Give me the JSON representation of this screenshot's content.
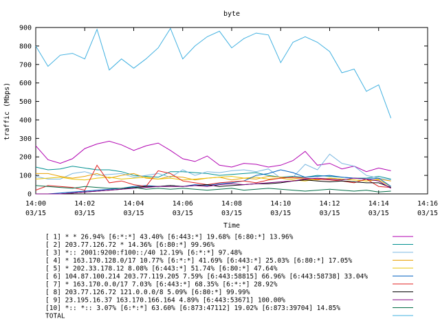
{
  "chart_data": {
    "type": "line",
    "title": "byte",
    "xlabel": "Time",
    "ylabel": "traffic (Mbps)",
    "ylim": [
      0,
      900
    ],
    "yticks": [
      "0",
      "100",
      "200",
      "300",
      "400",
      "500",
      "600",
      "700",
      "800",
      "900"
    ],
    "xlim": [
      "14:00",
      "14:16"
    ],
    "xticks": [
      {
        "time": "14:00",
        "date": "03/15"
      },
      {
        "time": "14:02",
        "date": "03/15"
      },
      {
        "time": "14:04",
        "date": "03/15"
      },
      {
        "time": "14:06",
        "date": "03/15"
      },
      {
        "time": "14:08",
        "date": "03/15"
      },
      {
        "time": "14:10",
        "date": "03/15"
      },
      {
        "time": "14:12",
        "date": "03/15"
      },
      {
        "time": "14:14",
        "date": "03/15"
      },
      {
        "time": "14:16",
        "date": "03/15"
      }
    ],
    "x": [
      "14:00:00",
      "14:00:30",
      "14:01:00",
      "14:01:30",
      "14:02:00",
      "14:02:30",
      "14:03:00",
      "14:03:30",
      "14:04:00",
      "14:04:30",
      "14:05:00",
      "14:05:30",
      "14:06:00",
      "14:06:30",
      "14:07:00",
      "14:07:30",
      "14:08:00",
      "14:08:30",
      "14:09:00",
      "14:09:30",
      "14:10:00",
      "14:10:30",
      "14:11:00",
      "14:11:30",
      "14:12:00",
      "14:12:30",
      "14:13:00",
      "14:13:30",
      "14:14:00",
      "14:14:30",
      "14:15:00"
    ],
    "grid": false,
    "legend_placement": "bottom",
    "series": [
      {
        "name": "[ 1] * * 26.94%  [6:*:*] 43.40% [6:443:*] 19.68% [6:80:*] 13.96%",
        "color": "#b000b0",
        "values": [
          260,
          185,
          165,
          190,
          245,
          270,
          285,
          265,
          235,
          260,
          275,
          235,
          190,
          175,
          205,
          155,
          145,
          165,
          160,
          145,
          155,
          180,
          230,
          155,
          165,
          135,
          150,
          120,
          140,
          125,
          null
        ]
      },
      {
        "name": "[ 2] 203.77.126.72 * 14.36%  [6:80:*] 99.96%",
        "color": "#009090",
        "values": [
          145,
          130,
          135,
          150,
          140,
          130,
          130,
          120,
          100,
          95,
          90,
          120,
          120,
          115,
          110,
          100,
          105,
          110,
          115,
          100,
          90,
          95,
          90,
          100,
          95,
          90,
          85,
          85,
          95,
          80,
          null
        ]
      },
      {
        "name": "[ 3] *:: 2001:9200:f100::/40 12.19%  [6:*:*] 97.48%",
        "color": "#7ab7e0",
        "values": [
          95,
          80,
          80,
          110,
          120,
          100,
          105,
          110,
          90,
          100,
          110,
          90,
          130,
          100,
          120,
          115,
          125,
          130,
          120,
          135,
          85,
          90,
          160,
          130,
          215,
          165,
          150,
          100,
          85,
          75,
          null
        ]
      },
      {
        "name": "[ 4] * 163.170.128.0/17 10.77%  [6:*:*] 41.69% [6:443:*] 25.03% [6:80:*] 17.05%",
        "color": "#e8a000",
        "values": [
          110,
          110,
          95,
          85,
          95,
          110,
          85,
          100,
          110,
          85,
          80,
          95,
          90,
          75,
          85,
          90,
          75,
          85,
          80,
          95,
          90,
          85,
          80,
          75,
          85,
          80,
          75,
          70,
          80,
          70,
          null
        ]
      },
      {
        "name": "[ 5] * 202.33.178.12 8.08%  [6:443:*] 51.74% [6:80:*] 47.64%",
        "color": "#e8c000",
        "values": [
          80,
          85,
          90,
          80,
          75,
          85,
          90,
          80,
          85,
          90,
          80,
          85,
          75,
          80,
          85,
          90,
          95,
          85,
          90,
          80,
          85,
          75,
          70,
          80,
          85,
          80,
          75,
          70,
          75,
          40,
          null
        ]
      },
      {
        "name": "[ 6] 104.87.100.214 203.77.119.205 7.59%  [6:443:58815] 66.96% [6:443:58738] 33.04%",
        "color": "#0060c0",
        "values": [
          0,
          0,
          5,
          10,
          15,
          20,
          25,
          30,
          40,
          45,
          40,
          45,
          40,
          50,
          45,
          55,
          60,
          70,
          100,
          110,
          130,
          115,
          90,
          95,
          100,
          90,
          85,
          80,
          85,
          40,
          null
        ]
      },
      {
        "name": "[ 7] * 163.170.0.0/17 7.03%  [6:443:*] 68.35% [6:*:*] 28.92%",
        "color": "#e02020",
        "values": [
          20,
          45,
          40,
          35,
          20,
          155,
          60,
          70,
          50,
          40,
          125,
          110,
          70,
          60,
          50,
          60,
          65,
          70,
          60,
          75,
          85,
          90,
          85,
          80,
          75,
          70,
          60,
          80,
          40,
          35,
          null
        ]
      },
      {
        "name": "[ 8] 203.77.126.72 121.0.0.0/8 5.09%  [6:80:*] 99.99%",
        "color": "#000000",
        "values": [
          0,
          0,
          0,
          5,
          10,
          15,
          20,
          25,
          35,
          40,
          40,
          45,
          40,
          45,
          50,
          40,
          45,
          50,
          55,
          55,
          60,
          70,
          75,
          70,
          65,
          70,
          65,
          60,
          60,
          35,
          null
        ]
      },
      {
        "name": "[ 9] 23.195.16.37 163.170.166.164 4.89%  [6:443:53671] 100.00%",
        "color": "#800080",
        "values": [
          0,
          0,
          0,
          5,
          10,
          15,
          20,
          25,
          30,
          35,
          40,
          40,
          40,
          45,
          40,
          50,
          55,
          50,
          55,
          60,
          65,
          70,
          80,
          85,
          80,
          75,
          85,
          80,
          70,
          30,
          null
        ]
      },
      {
        "name": "[10] *:: *:: 3.07%  [6:*:*] 63.60% [6:873:47112] 19.02% [6:873:39704] 14.85%",
        "color": "#006c44",
        "values": [
          45,
          40,
          35,
          30,
          40,
          35,
          30,
          30,
          35,
          25,
          30,
          25,
          30,
          25,
          20,
          25,
          30,
          20,
          25,
          30,
          25,
          20,
          15,
          20,
          25,
          20,
          15,
          20,
          10,
          15,
          null
        ]
      },
      {
        "name": "TOTAL",
        "color": "#40b0e0",
        "values": [
          800,
          690,
          750,
          760,
          730,
          890,
          670,
          730,
          680,
          730,
          790,
          895,
          730,
          800,
          850,
          880,
          790,
          840,
          870,
          860,
          710,
          820,
          850,
          820,
          770,
          655,
          675,
          555,
          590,
          410,
          null
        ]
      }
    ]
  }
}
